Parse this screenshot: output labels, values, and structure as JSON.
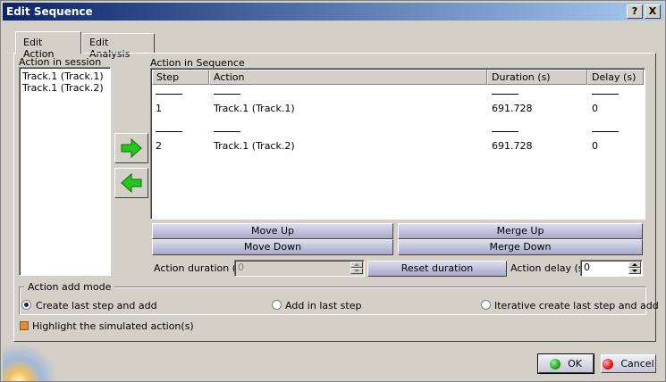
{
  "window": {
    "title": "Edit Sequence",
    "help_label": "?",
    "close_label": "X"
  },
  "tabs": [
    {
      "label": "Edit Action",
      "active": true
    },
    {
      "label": "Edit Analysis",
      "active": false
    }
  ],
  "session": {
    "label": "Action in session",
    "items": [
      "Track.1 (Track.1)",
      "Track.1 (Track.2)"
    ]
  },
  "sequence": {
    "label": "Action in Sequence",
    "columns": [
      "Step",
      "Action",
      "Duration (s)",
      "Delay (s)"
    ],
    "rows": [
      {
        "step": "1",
        "action": "Track.1 (Track.1)",
        "duration": "691.728",
        "delay": "0"
      },
      {
        "step": "2",
        "action": "Track.1 (Track.2)",
        "duration": "691.728",
        "delay": "0"
      }
    ]
  },
  "buttons": {
    "move_up": "Move Up",
    "move_down": "Move Down",
    "merge_up": "Merge Up",
    "merge_down": "Merge Down",
    "reset_duration": "Reset duration"
  },
  "fields": {
    "action_duration_label": "Action duration (s)",
    "action_duration_value": "0",
    "action_delay_label": "Action delay (s)",
    "action_delay_value": "0"
  },
  "add_mode": {
    "label": "Action add mode",
    "options": [
      {
        "label": "Create last step and add",
        "checked": true
      },
      {
        "label": "Add in last step",
        "checked": false
      },
      {
        "label": "Iterative create last step and add",
        "checked": false
      }
    ]
  },
  "highlight": {
    "label": "Highlight the simulated action(s)",
    "checked": true
  },
  "dialog": {
    "ok_label": "OK",
    "cancel_label": "Cancel"
  },
  "colors": {
    "arrow_green": "#22c81e",
    "ok_green": "#1fa81f",
    "cancel_red": "#d81818",
    "title_blue": "#0a246a"
  }
}
